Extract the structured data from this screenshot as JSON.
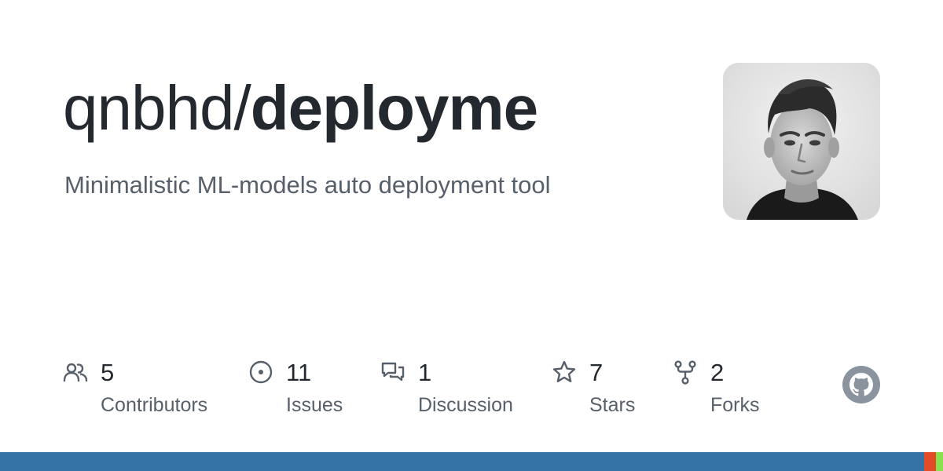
{
  "repo": {
    "owner": "qnbhd",
    "separator": "/",
    "name": "deployme",
    "description": "Minimalistic ML-models auto deployment tool"
  },
  "stats": [
    {
      "icon": "contributors-icon",
      "count": "5",
      "label": "Contributors"
    },
    {
      "icon": "issues-icon",
      "count": "11",
      "label": "Issues"
    },
    {
      "icon": "discussion-icon",
      "count": "1",
      "label": "Discussion"
    },
    {
      "icon": "star-icon",
      "count": "7",
      "label": "Stars"
    },
    {
      "icon": "fork-icon",
      "count": "2",
      "label": "Forks"
    }
  ],
  "colors": {
    "title": "#24292f",
    "muted": "#57606a",
    "icon": "#57606a",
    "github_mark": "#8b949e"
  },
  "language_bar": [
    {
      "color": "#3572A5",
      "fraction": 0.98
    },
    {
      "color": "#e34c26",
      "fraction": 0.0125
    },
    {
      "color": "#89e051",
      "fraction": 0.0075
    }
  ]
}
